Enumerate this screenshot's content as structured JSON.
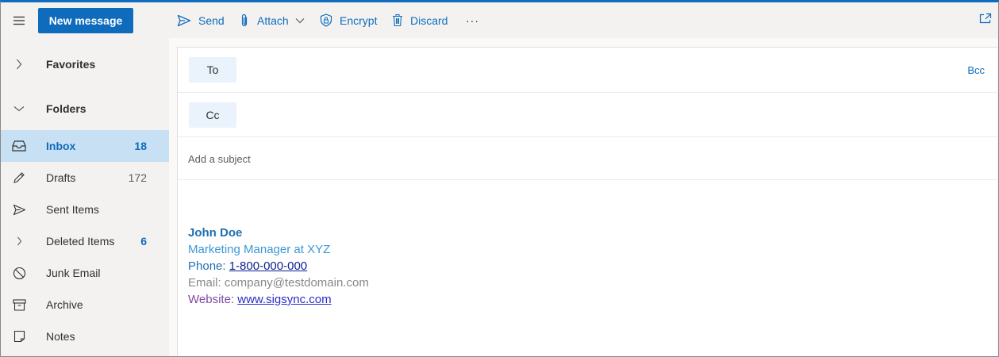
{
  "toolbar": {
    "new_message": "New message",
    "send": "Send",
    "attach": "Attach",
    "encrypt": "Encrypt",
    "discard": "Discard",
    "more": "···"
  },
  "nav": {
    "favorites": "Favorites",
    "folders": "Folders",
    "items": [
      {
        "label": "Inbox",
        "count": "18",
        "icon": "inbox-icon"
      },
      {
        "label": "Drafts",
        "count": "172",
        "icon": "pencil-icon"
      },
      {
        "label": "Sent Items",
        "count": "",
        "icon": "send-icon"
      },
      {
        "label": "Deleted Items",
        "count": "6",
        "icon": "chevron-right-icon"
      },
      {
        "label": "Junk Email",
        "count": "",
        "icon": "block-icon"
      },
      {
        "label": "Archive",
        "count": "",
        "icon": "archive-icon"
      },
      {
        "label": "Notes",
        "count": "",
        "icon": "note-icon"
      }
    ]
  },
  "compose": {
    "to": "To",
    "cc": "Cc",
    "bcc": "Bcc",
    "subject_placeholder": "Add a subject"
  },
  "signature": {
    "name": "John Doe",
    "title": "Marketing Manager at XYZ",
    "phone_label": "Phone: ",
    "phone": "1-800-000-000",
    "email_line": "Email: company@testdomain.com",
    "website_label": "Website: ",
    "website": "www.sigsync.com"
  },
  "colors": {
    "accent": "#0f6cbd",
    "selected_bg": "#c7e0f4"
  }
}
